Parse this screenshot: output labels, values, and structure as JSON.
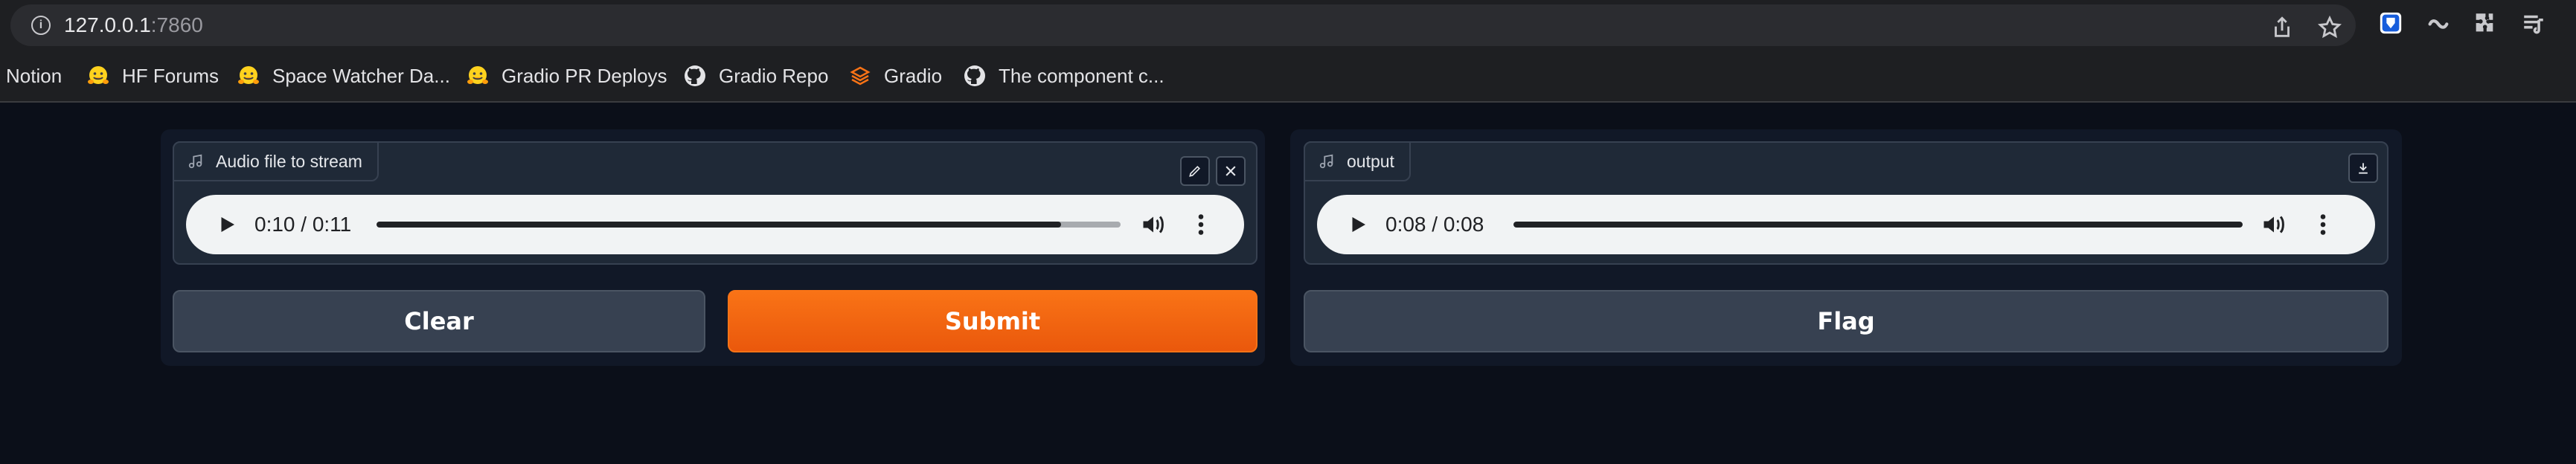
{
  "browser": {
    "url_host": "127.0.0.1",
    "url_port": ":7860",
    "icons": [
      "info-icon",
      "share-icon",
      "star-icon",
      "extension-bitwarden-icon",
      "extension-link-icon",
      "puzzle-icon",
      "reading-list-icon"
    ]
  },
  "bookmarks": [
    {
      "label": "Notion",
      "icon": ""
    },
    {
      "label": "HF Forums",
      "icon": "hugging-face-icon"
    },
    {
      "label": "Space Watcher Da...",
      "icon": "hugging-face-icon"
    },
    {
      "label": "Gradio PR Deploys",
      "icon": "hugging-face-icon"
    },
    {
      "label": "Gradio Repo",
      "icon": "github-icon"
    },
    {
      "label": "Gradio",
      "icon": "gradio-icon"
    },
    {
      "label": "The component c...",
      "icon": "github-icon"
    }
  ],
  "input_audio": {
    "label": "Audio file to stream",
    "time": "0:10 / 0:11",
    "progress": 0.92
  },
  "output_audio": {
    "label": "output",
    "time": "0:08 / 0:08",
    "progress": 1.0
  },
  "buttons": {
    "clear": "Clear",
    "submit": "Submit",
    "flag": "Flag"
  },
  "colors": {
    "accent": "#f97316",
    "background": "#0b0f19",
    "panel": "#111827",
    "block": "#1f2937",
    "secondary_button": "#374151"
  }
}
